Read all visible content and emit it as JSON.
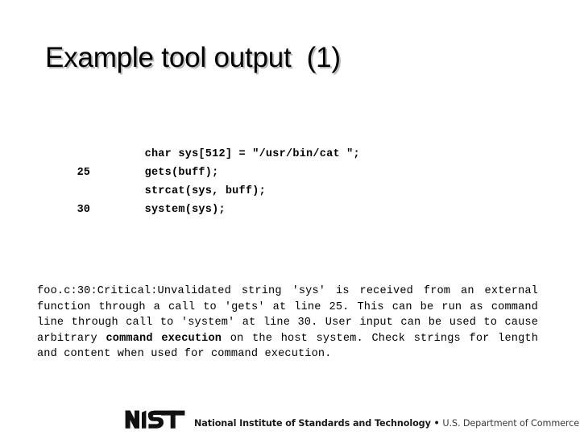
{
  "slide": {
    "title": "Example tool output  (1)",
    "background_color": "#ffffff",
    "text_color": "#000000",
    "title_shadow_color": "#828282"
  },
  "code_listing": {
    "language": "c",
    "rows": [
      {
        "lineno": "",
        "code": "char sys[512] = \"/usr/bin/cat \";"
      },
      {
        "lineno": "25",
        "code": "gets(buff);"
      },
      {
        "lineno": "",
        "code": "strcat(sys, buff);"
      },
      {
        "lineno": "30",
        "code": "system(sys);"
      }
    ]
  },
  "analysis": {
    "part1": "foo.c:30:Critical:Unvalidated string 'sys' is received from an external function through a call to 'gets' at line 25. This can be run as command line through call to 'system' at line 30. User input can be used to cause arbitrary ",
    "emphasis": "command execution",
    "part2": " on the host system. Check strings for length and content when used for command execution."
  },
  "footer": {
    "logo_text": "NIST",
    "organization": "National Institute of Standards and Technology",
    "separator": " • ",
    "department": "U.S. Department of Commerce"
  }
}
